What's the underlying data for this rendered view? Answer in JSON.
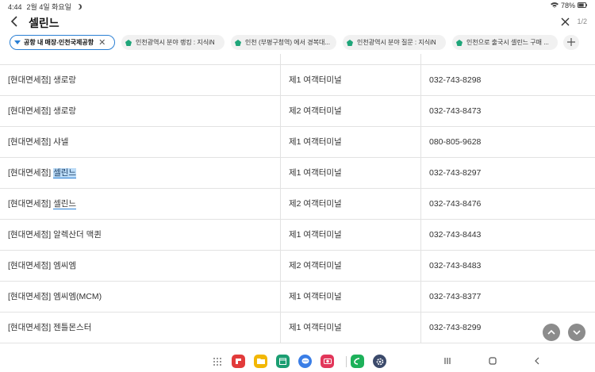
{
  "status": {
    "time": "4:44",
    "date": "2월 4일 화요일",
    "battery": "78%"
  },
  "find": {
    "query": "셀린느",
    "match_count": "1/2"
  },
  "tabs": [
    {
      "label": "공항 내 매장-인천국제공항",
      "active": true
    },
    {
      "label": "인천광역시 분야 랭킹 : 지식iN",
      "active": false
    },
    {
      "label": "인천 (부평구청역) 에서 경복대...",
      "active": false
    },
    {
      "label": "인천광역시 분야 질문 : 지식iN",
      "active": false
    },
    {
      "label": "인천으로 출국시 셀린느 구매 ...",
      "active": false
    }
  ],
  "rows": [
    {
      "prefix": "[현대면세점] ",
      "name": "생로랑",
      "terminal": "제1 여객터미널",
      "phone": "032-743-8298"
    },
    {
      "prefix": "[현대면세점] ",
      "name": "생로랑",
      "terminal": "제2 여객터미널",
      "phone": "032-743-8473"
    },
    {
      "prefix": "[현대면세점] ",
      "name": "샤넬",
      "terminal": "제1 여객터미널",
      "phone": "080-805-9628"
    },
    {
      "prefix": "[현대면세점] ",
      "name": "셀린느",
      "terminal": "제1 여객터미널",
      "phone": "032-743-8297"
    },
    {
      "prefix": "[현대면세점] ",
      "name": "셀린느",
      "terminal": "제2 여객터미널",
      "phone": "032-743-8476"
    },
    {
      "prefix": "[현대면세점] ",
      "name": "알렉산더 맥퀸",
      "terminal": "제1 여객터미널",
      "phone": "032-743-8443"
    },
    {
      "prefix": "[현대면세점] ",
      "name": "엠씨엠",
      "terminal": "제2 여객터미널",
      "phone": "032-743-8483"
    },
    {
      "prefix": "[현대면세점] ",
      "name": "엠씨엠(MCM)",
      "terminal": "제1 여객터미널",
      "phone": "032-743-8377"
    },
    {
      "prefix": "[현대면세점] ",
      "name": "젠틀몬스터",
      "terminal": "제1 여객터미널",
      "phone": "032-743-8299"
    }
  ],
  "colors": {
    "accent": "#2a7fd4",
    "highlight": "#bcdcf7"
  },
  "navbar_apps": [
    "flipboard-icon",
    "folder-icon",
    "calendar-icon",
    "messages-icon",
    "camera-icon",
    "phone-icon",
    "settings-icon"
  ]
}
